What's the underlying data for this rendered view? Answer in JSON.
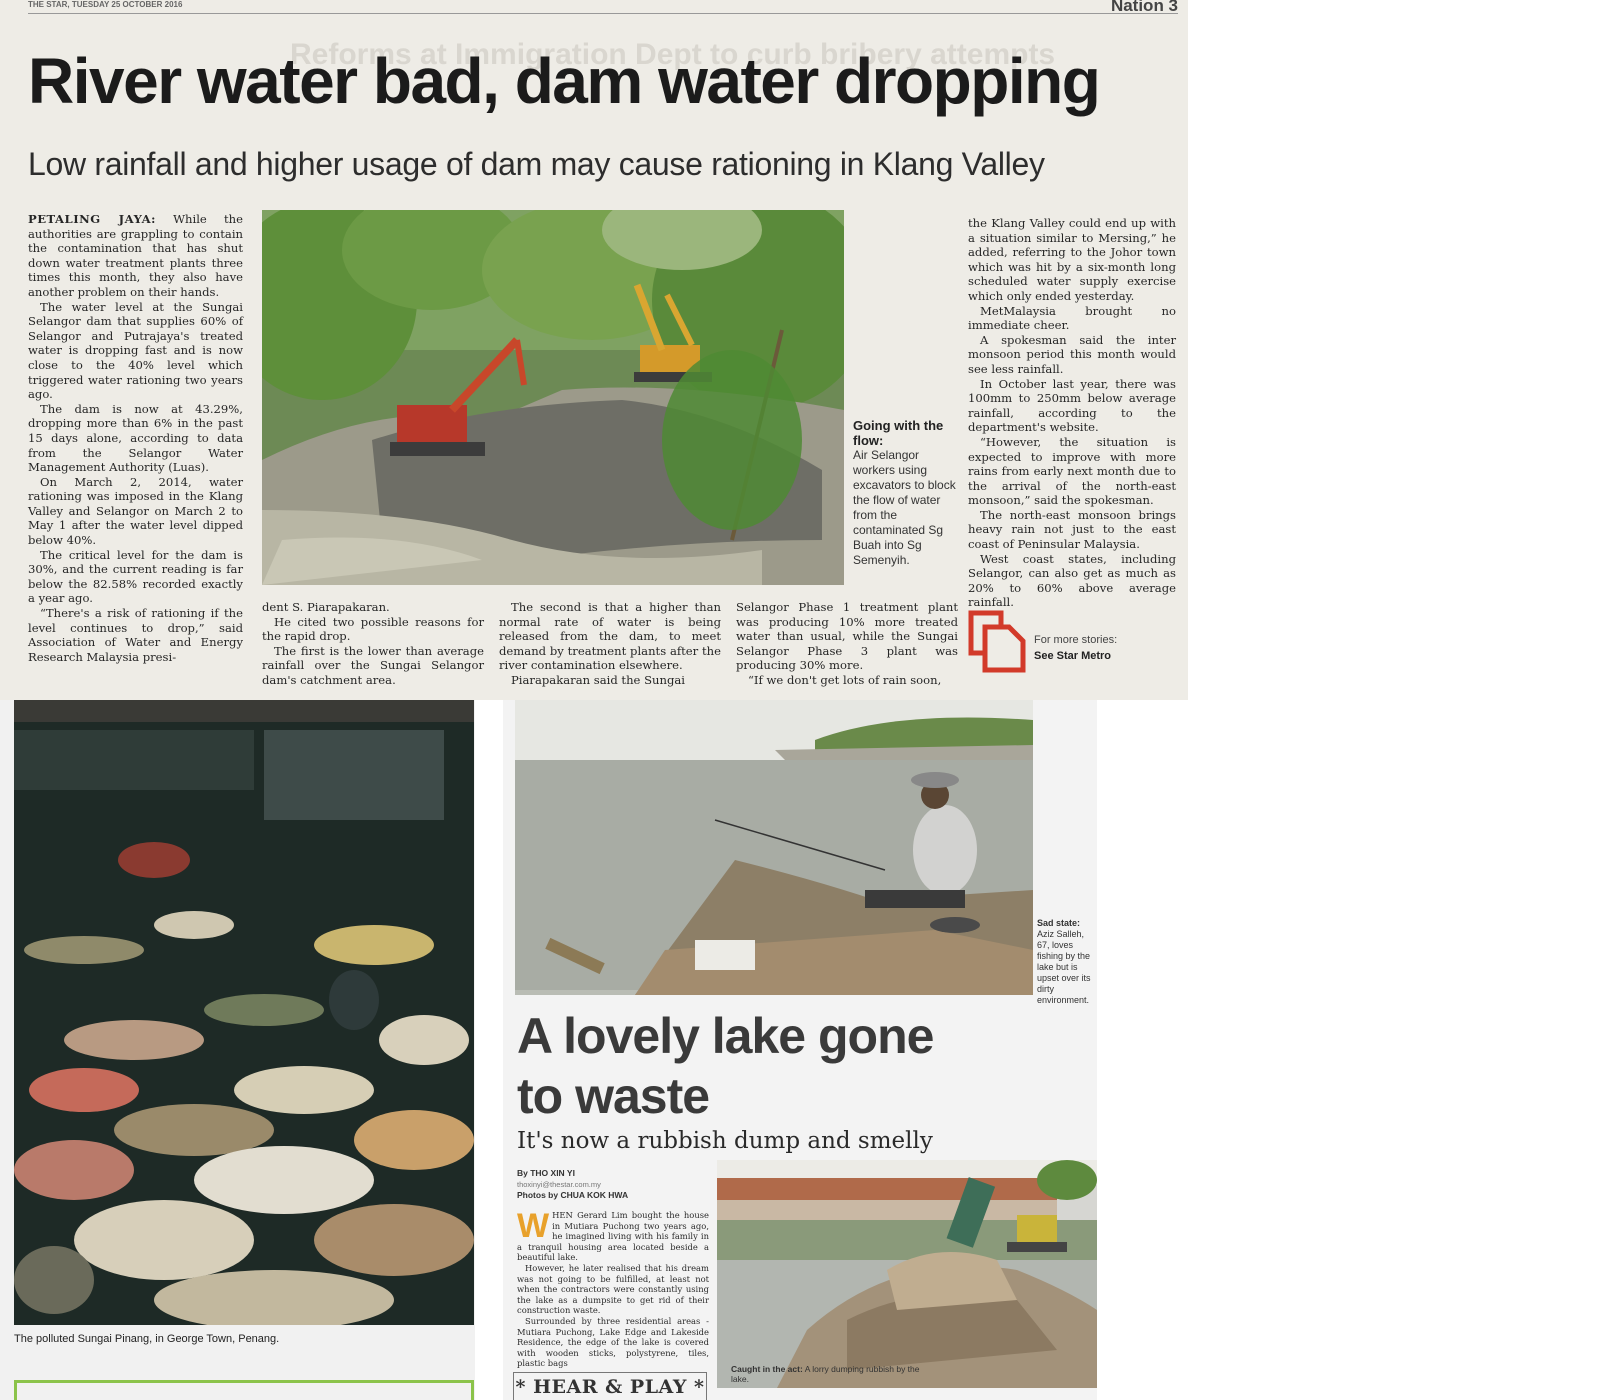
{
  "clip_top": {
    "runhead_date": "THE STAR, TUESDAY 25 OCTOBER 2016",
    "section": "Nation  3",
    "ghost_headline": "Reforms at Immigration Dept to curb bribery attempts",
    "headline": "River water bad, dam water dropping",
    "subheadline": "Low rainfall and higher usage of dam may cause rationing in Klang Valley",
    "dateline": "PETALING JAYA:",
    "col1": [
      "While the authorities are grappling to contain the contamination that has shut down water treatment plants three times this month, they also have another problem on their hands.",
      "The water level at the Sungai Selangor dam that supplies 60% of Selangor and Putrajaya's treated water is dropping fast and is now close to the 40% level which triggered water rationing two years ago.",
      "The dam is now at 43.29%, dropping more than 6% in the past 15 days alone, according to data from the Selangor Water Management Authority (Luas).",
      "On March 2, 2014, water rationing was imposed in the Klang Valley and Selangor on March 2 to May 1 after the water level dipped below 40%.",
      "The critical level for the dam is 30%, and the current reading is far below the 82.58% recorded exactly a year ago.",
      "“There's a risk of rationing if the level continues to drop,” said Association of Water and Energy Research Malaysia presi-"
    ],
    "col2": [
      "dent S. Piarapakaran.",
      "He cited two possible reasons for the rapid drop.",
      "The first is the lower than average rainfall over the Sungai Selangor dam's catchment area."
    ],
    "col3": [
      "The second is that a higher than normal rate of water is being released from the dam, to meet demand by treatment plants after the river contamination elsewhere.",
      "Piarapakaran said the Sungai"
    ],
    "col4": [
      "Selangor Phase 1 treatment plant was producing 10% more treated water than usual, while the Sungai Selangor Phase 3 plant was producing 30% more.",
      "“If we don't get lots of rain soon,"
    ],
    "col5": [
      "the Klang Valley could end up with a situation similar to Mersing,” he added, referring to the Johor town which was hit by a six-month long scheduled water supply exercise which only ended yesterday.",
      "MetMalaysia brought no immediate cheer.",
      "A spokesman said the inter monsoon period this month would see less rainfall.",
      "In October last year, there was 100mm to 250mm below average rainfall, according to the department's website.",
      "“However, the situation is expected to improve with more rains from early next month due to the arrival of the north-east monsoon,” said the spokesman.",
      "The north-east monsoon brings heavy rain not just to the east coast of Peninsular Malaysia.",
      "West coast states, including Selangor, can also get as much as 20% to 60% above average rainfall."
    ],
    "photo_caption_title": "Going with the flow:",
    "photo_caption_text": "Air Selangor workers using excavators to block the flow of water from the contaminated Sg Buah into Sg Semenyih.",
    "more_line1": "For more stories:",
    "more_line2": "See Star Metro"
  },
  "clip_river": {
    "caption": "The polluted Sungai Pinang, in George Town, Penang."
  },
  "clip_lake": {
    "headline": "A lovely lake gone to waste",
    "subheadline": "It's now a rubbish dump and smelly",
    "byline": "By THO XIN YI",
    "email": "thoxinyi@thestar.com.my",
    "photos_credit": "Photos by CHUA KOK HWA",
    "dropcap": "W",
    "body": [
      "HEN Gerard Lim bought the house in Mutiara Puchong two years ago, he imagined living with his family in a tranquil housing area located beside a beautiful lake.",
      "However, he later realised that his dream was not going to be fulfilled, at least not when the contractors were constantly using the lake as a dumpsite to get rid of their construction waste.",
      "Surrounded by three residential areas - Mutiara Puchong, Lake Edge and Lakeside Residence, the edge of the lake is covered with wooden sticks, polystyrene, tiles, plastic bags"
    ],
    "fisher_caption_title": "Sad state:",
    "fisher_caption_text": "Aziz Salleh, 67, loves fishing by the lake but is upset over its dirty environment.",
    "dump_caption_title": "Caught in the act:",
    "dump_caption_text": "A lorry dumping rubbish by the lake.",
    "hear_play": "* HEAR & PLAY *"
  }
}
